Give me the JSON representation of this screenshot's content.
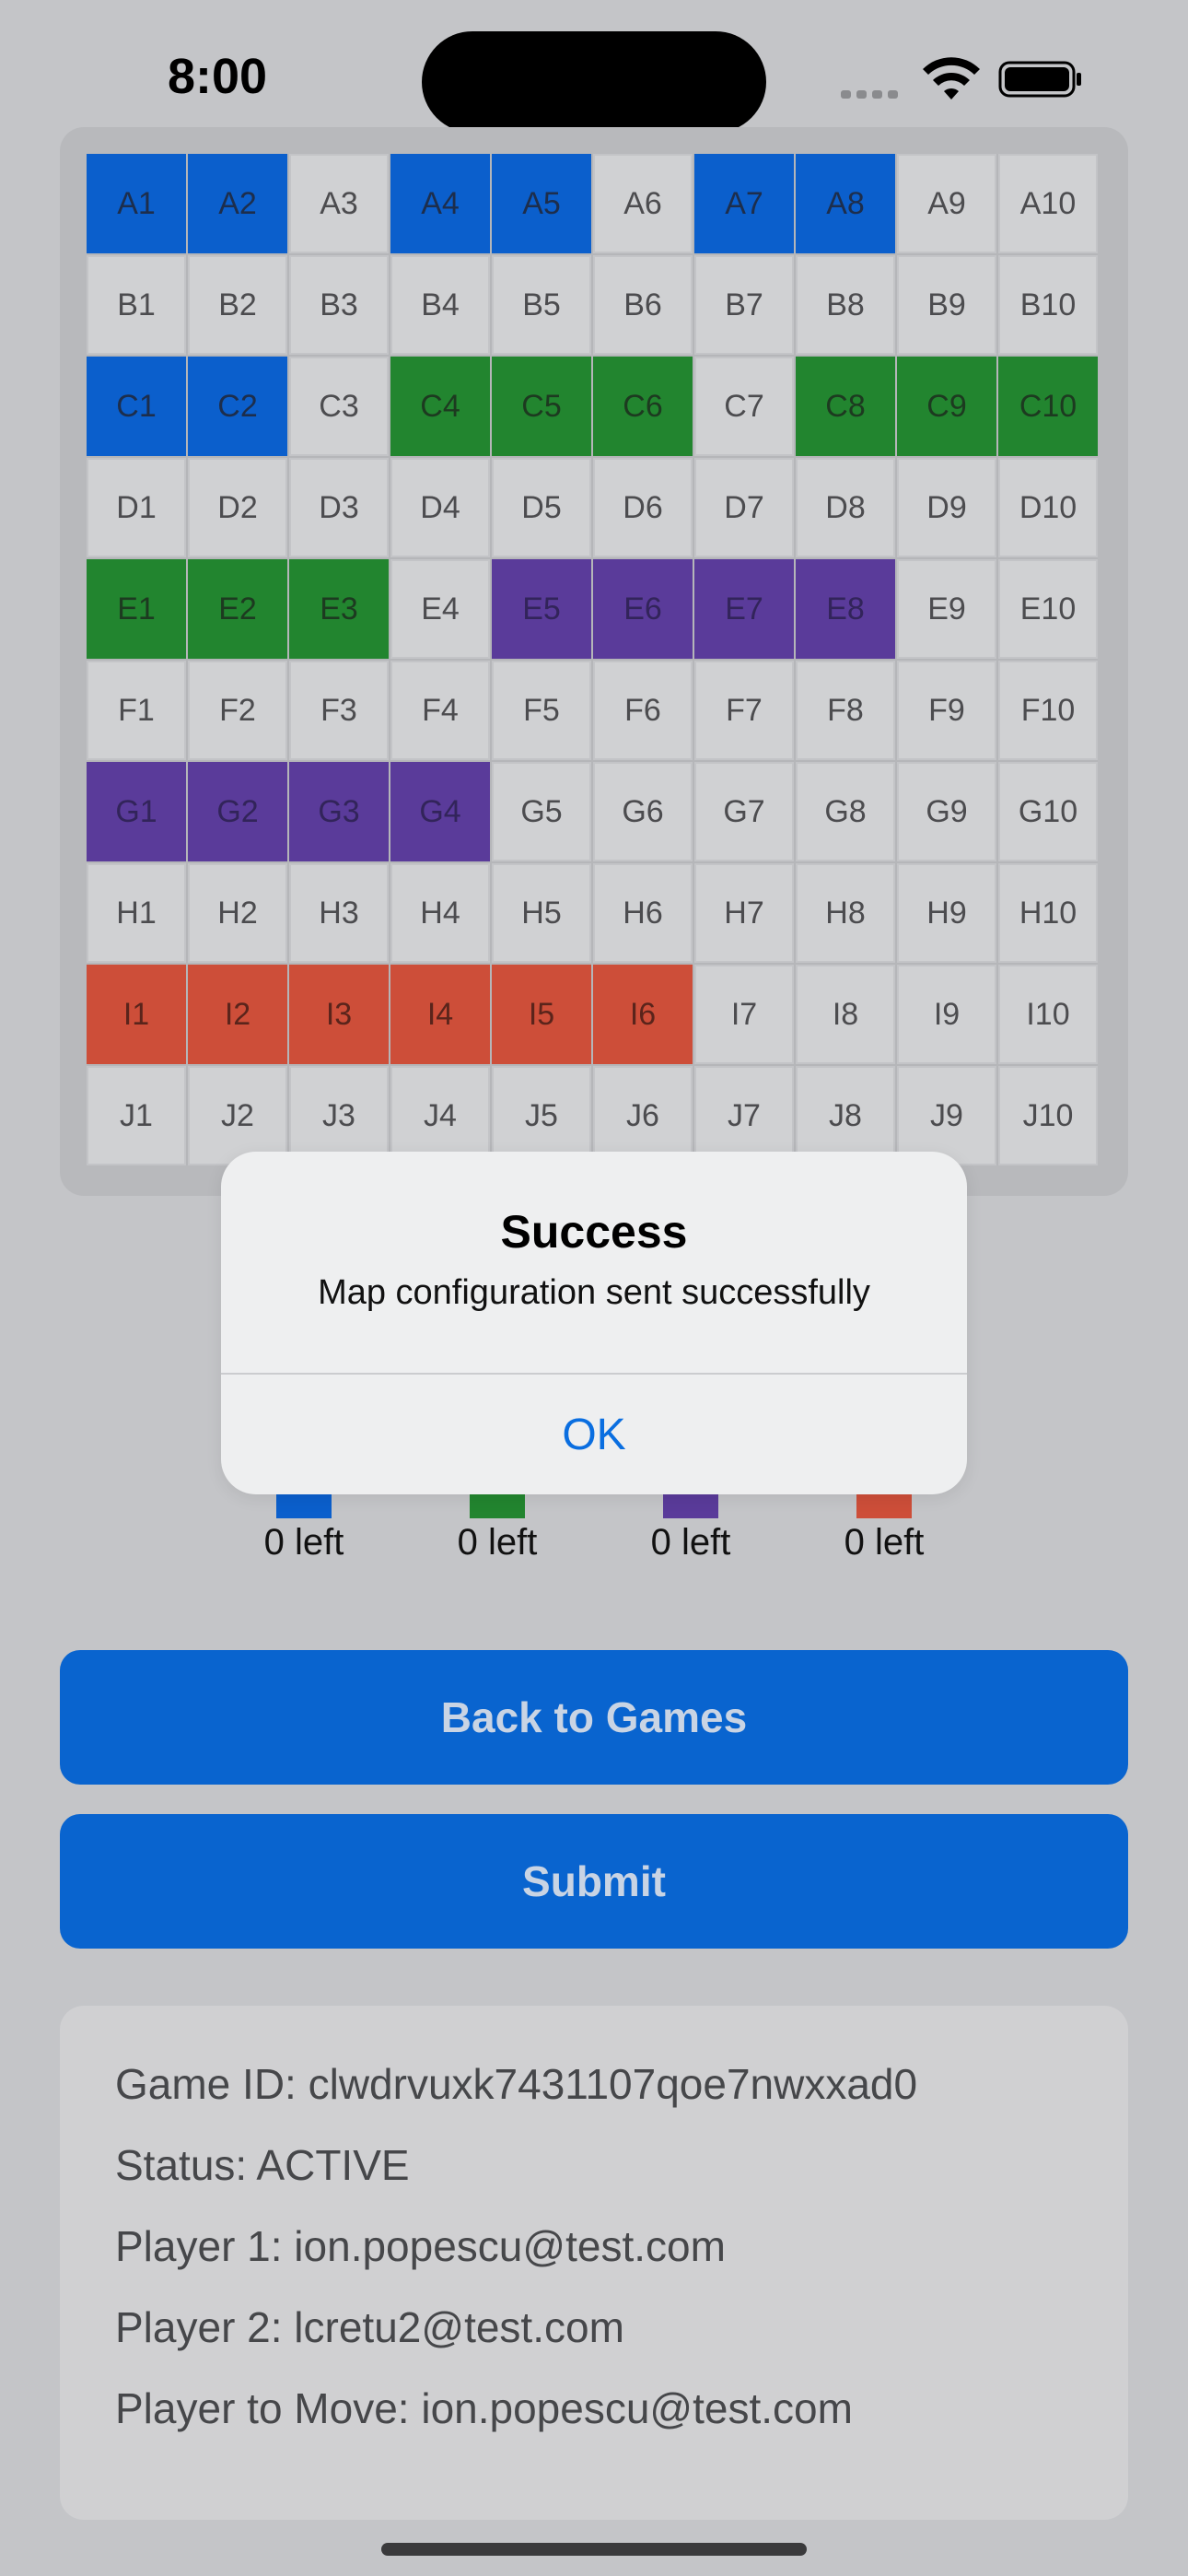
{
  "status_bar": {
    "time": "8:00"
  },
  "board": {
    "cells": [
      [
        "A1",
        "blue"
      ],
      [
        "A2",
        "blue"
      ],
      [
        "A3",
        ""
      ],
      [
        "A4",
        "blue"
      ],
      [
        "A5",
        "blue"
      ],
      [
        "A6",
        ""
      ],
      [
        "A7",
        "blue"
      ],
      [
        "A8",
        "blue"
      ],
      [
        "A9",
        ""
      ],
      [
        "A10",
        ""
      ],
      [
        "B1",
        ""
      ],
      [
        "B2",
        ""
      ],
      [
        "B3",
        ""
      ],
      [
        "B4",
        ""
      ],
      [
        "B5",
        ""
      ],
      [
        "B6",
        ""
      ],
      [
        "B7",
        ""
      ],
      [
        "B8",
        ""
      ],
      [
        "B9",
        ""
      ],
      [
        "B10",
        ""
      ],
      [
        "C1",
        "blue"
      ],
      [
        "C2",
        "blue"
      ],
      [
        "C3",
        ""
      ],
      [
        "C4",
        "green"
      ],
      [
        "C5",
        "green"
      ],
      [
        "C6",
        "green"
      ],
      [
        "C7",
        ""
      ],
      [
        "C8",
        "green"
      ],
      [
        "C9",
        "green"
      ],
      [
        "C10",
        "green"
      ],
      [
        "D1",
        ""
      ],
      [
        "D2",
        ""
      ],
      [
        "D3",
        ""
      ],
      [
        "D4",
        ""
      ],
      [
        "D5",
        ""
      ],
      [
        "D6",
        ""
      ],
      [
        "D7",
        ""
      ],
      [
        "D8",
        ""
      ],
      [
        "D9",
        ""
      ],
      [
        "D10",
        ""
      ],
      [
        "E1",
        "green"
      ],
      [
        "E2",
        "green"
      ],
      [
        "E3",
        "green"
      ],
      [
        "E4",
        ""
      ],
      [
        "E5",
        "purple"
      ],
      [
        "E6",
        "purple"
      ],
      [
        "E7",
        "purple"
      ],
      [
        "E8",
        "purple"
      ],
      [
        "E9",
        ""
      ],
      [
        "E10",
        ""
      ],
      [
        "F1",
        ""
      ],
      [
        "F2",
        ""
      ],
      [
        "F3",
        ""
      ],
      [
        "F4",
        ""
      ],
      [
        "F5",
        ""
      ],
      [
        "F6",
        ""
      ],
      [
        "F7",
        ""
      ],
      [
        "F8",
        ""
      ],
      [
        "F9",
        ""
      ],
      [
        "F10",
        ""
      ],
      [
        "G1",
        "purple"
      ],
      [
        "G2",
        "purple"
      ],
      [
        "G3",
        "purple"
      ],
      [
        "G4",
        "purple"
      ],
      [
        "G5",
        ""
      ],
      [
        "G6",
        ""
      ],
      [
        "G7",
        ""
      ],
      [
        "G8",
        ""
      ],
      [
        "G9",
        ""
      ],
      [
        "G10",
        ""
      ],
      [
        "H1",
        ""
      ],
      [
        "H2",
        ""
      ],
      [
        "H3",
        ""
      ],
      [
        "H4",
        ""
      ],
      [
        "H5",
        ""
      ],
      [
        "H6",
        ""
      ],
      [
        "H7",
        ""
      ],
      [
        "H8",
        ""
      ],
      [
        "H9",
        ""
      ],
      [
        "H10",
        ""
      ],
      [
        "I1",
        "red"
      ],
      [
        "I2",
        "red"
      ],
      [
        "I3",
        "red"
      ],
      [
        "I4",
        "red"
      ],
      [
        "I5",
        "red"
      ],
      [
        "I6",
        "red"
      ],
      [
        "I7",
        ""
      ],
      [
        "I8",
        ""
      ],
      [
        "I9",
        ""
      ],
      [
        "I10",
        ""
      ],
      [
        "J1",
        ""
      ],
      [
        "J2",
        ""
      ],
      [
        "J3",
        ""
      ],
      [
        "J4",
        ""
      ],
      [
        "J5",
        ""
      ],
      [
        "J6",
        ""
      ],
      [
        "J7",
        ""
      ],
      [
        "J8",
        ""
      ],
      [
        "J9",
        ""
      ],
      [
        "J10",
        ""
      ]
    ]
  },
  "ships": [
    {
      "color": "#0b5fcc",
      "count": "0 left"
    },
    {
      "color": "#22852f",
      "count": "0 left"
    },
    {
      "color": "#5a3b9a",
      "count": "0 left"
    },
    {
      "color": "#cd4e39",
      "count": "0 left"
    }
  ],
  "actions": {
    "back_label": "Back to Games",
    "submit_label": "Submit"
  },
  "info": {
    "game_id": "Game ID: clwdrvuxk7431107qoe7nwxxad0",
    "status": "Status: ACTIVE",
    "player1": "Player 1: ion.popescu@test.com",
    "player2": "Player 2: lcretu2@test.com",
    "player_to_move": "Player to Move: ion.popescu@test.com"
  },
  "alert": {
    "title": "Success",
    "message": "Map configuration sent successfully",
    "ok_label": "OK"
  }
}
